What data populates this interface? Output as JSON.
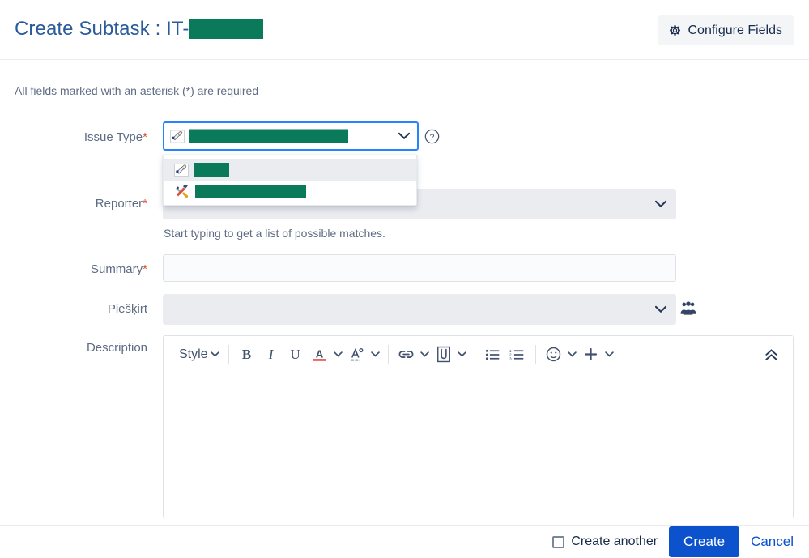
{
  "header": {
    "title_prefix": "Create Subtask : IT-",
    "title_redacted": true,
    "configure_fields_label": "Configure Fields",
    "configure_fields_icon": "gear-icon"
  },
  "form": {
    "required_hint": "All fields marked with an asterisk (*) are required",
    "required_marker": "*",
    "fields": {
      "issue_type": {
        "label": "Issue Type",
        "required": true,
        "value_redacted": true,
        "icon": "subtask-icon",
        "focused": true,
        "help_icon": "question-circle-icon",
        "dropdown_open": true,
        "options": [
          {
            "icon": "subtask-icon",
            "label_redacted": true,
            "selected": true
          },
          {
            "icon": "tools-icon",
            "label_redacted": true,
            "selected": false
          }
        ]
      },
      "reporter": {
        "label": "Reporter",
        "required": true,
        "value": "",
        "hint": "Start typing to get a list of possible matches.",
        "chevron_icon": "chevron-down-icon"
      },
      "summary": {
        "label": "Summary",
        "required": true,
        "value": "",
        "placeholder": ""
      },
      "assignee": {
        "label": "Piešķirt",
        "required": false,
        "value": "",
        "chevron_icon": "chevron-down-icon",
        "group_picker_icon": "user-group-icon"
      },
      "description": {
        "label": "Description",
        "value": "",
        "toolbar": {
          "style_label": "Style",
          "buttons": [
            {
              "name": "style-dropdown",
              "glyph": "Style"
            },
            {
              "name": "bold-button",
              "glyph": "B"
            },
            {
              "name": "italic-button",
              "glyph": "I"
            },
            {
              "name": "underline-button",
              "glyph": "U"
            },
            {
              "name": "text-color-button",
              "glyph": "A"
            },
            {
              "name": "text-format-more-button",
              "glyph": "A°"
            },
            {
              "name": "link-button",
              "glyph": "link"
            },
            {
              "name": "attachment-button",
              "glyph": "paperclip"
            },
            {
              "name": "bullet-list-button",
              "glyph": "bullets"
            },
            {
              "name": "numbered-list-button",
              "glyph": "numbers"
            },
            {
              "name": "emoji-button",
              "glyph": "smiley"
            },
            {
              "name": "insert-more-button",
              "glyph": "plus"
            },
            {
              "name": "collapse-toolbar-button",
              "glyph": "double-chevron-up"
            }
          ]
        }
      }
    }
  },
  "footer": {
    "create_another_label": "Create another",
    "create_another_checked": false,
    "create_label": "Create",
    "cancel_label": "Cancel"
  },
  "colors": {
    "title_blue": "#2a5b9b",
    "redaction_green": "#0b7a5a",
    "focus_blue": "#2684ff",
    "primary_button": "#0b52cc",
    "link_blue": "#0b52cc",
    "required_red": "#de5239",
    "label_grey": "#5e6c84",
    "field_grey": "#ebecf0"
  }
}
